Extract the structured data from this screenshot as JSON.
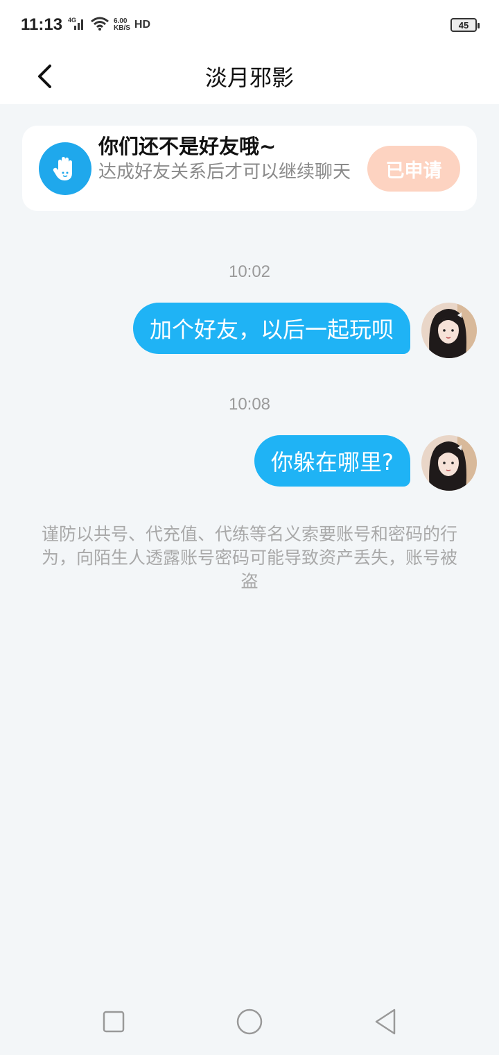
{
  "status_bar": {
    "time": "11:13",
    "network": "4G",
    "speed_value": "6.00",
    "speed_unit": "KB/S",
    "hd": "HD",
    "battery": "45"
  },
  "header": {
    "title": "淡月邪影"
  },
  "notice": {
    "title": "你们还不是好友哦~",
    "subtitle": "达成好友关系后才可以继续聊天",
    "button_label": "已申请"
  },
  "messages": [
    {
      "time": "10:02",
      "text": "加个好友，以后一起玩呗"
    },
    {
      "time": "10:08",
      "text": "你躲在哪里?"
    }
  ],
  "warning": "谨防以共号、代充值、代练等名义索要账号和密码的行为，向陌生人透露账号密码可能导致资产丢失，账号被盗",
  "colors": {
    "accent": "#1fb3f5",
    "applied_button": "#fdd3c1",
    "background": "#f3f6f8"
  }
}
